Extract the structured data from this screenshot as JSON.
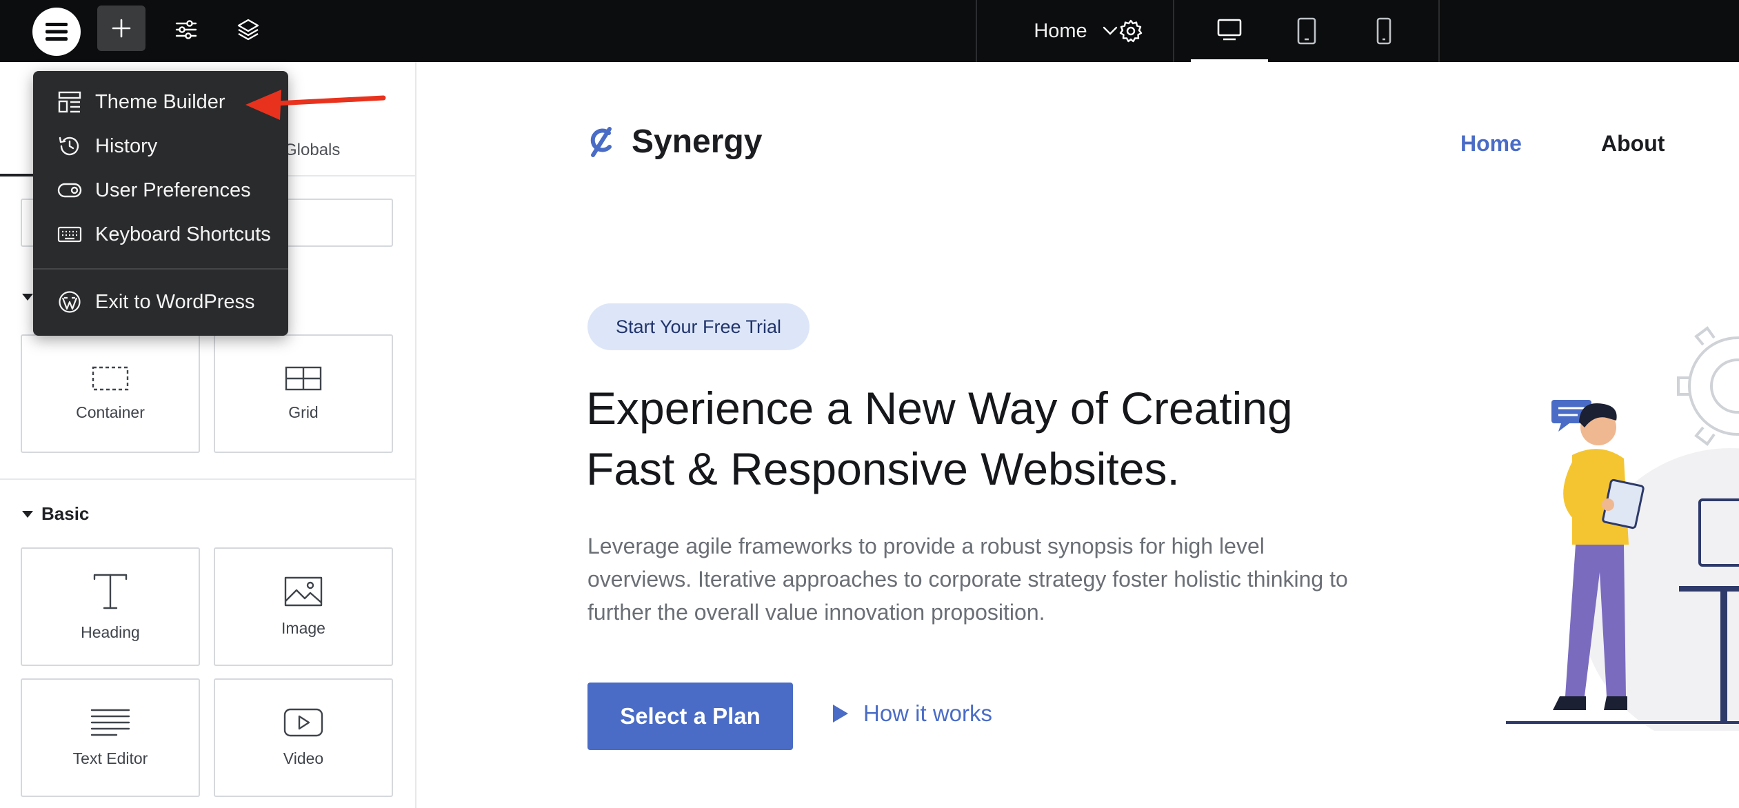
{
  "topbar": {
    "page_selector": {
      "label": "Home"
    },
    "icons": {
      "main_menu": "hamburger-icon",
      "add": "plus-icon",
      "site_settings": "sliders-icon",
      "structure": "layers-icon",
      "page_settings": "gear-icon",
      "devices": [
        "desktop-icon",
        "tablet-icon",
        "mobile-icon"
      ]
    }
  },
  "menu": {
    "items": [
      {
        "label": "Theme Builder",
        "icon": "theme-builder-icon"
      },
      {
        "label": "History",
        "icon": "history-icon"
      },
      {
        "label": "User Preferences",
        "icon": "toggle-icon"
      },
      {
        "label": "Keyboard Shortcuts",
        "icon": "keyboard-icon"
      }
    ],
    "exit": {
      "label": "Exit to WordPress",
      "icon": "wordpress-icon"
    }
  },
  "panel": {
    "tabs": {
      "globals": "Globals"
    },
    "layout_widgets": [
      {
        "label": "Container",
        "icon": "container-icon"
      },
      {
        "label": "Grid",
        "icon": "grid-icon"
      }
    ],
    "basic_section": {
      "title": "Basic"
    },
    "basic_widgets": [
      {
        "label": "Heading",
        "icon": "heading-icon"
      },
      {
        "label": "Image",
        "icon": "image-icon"
      },
      {
        "label": "Text Editor",
        "icon": "text-editor-icon"
      },
      {
        "label": "Video",
        "icon": "video-icon"
      }
    ]
  },
  "site": {
    "brand": "Synergy",
    "nav": [
      "Home",
      "About"
    ],
    "badge": "Start Your Free Trial",
    "hero_title_line1": "Experience a New Way of Creating",
    "hero_title_line2": "Fast & Responsive Websites.",
    "hero_text_line1": "Leverage agile frameworks to provide a robust synopsis for high level",
    "hero_text_line2": "overviews. Iterative approaches to corporate strategy foster holistic thinking to",
    "hero_text_line3": "further the overall value innovation proposition.",
    "cta": "Select a Plan",
    "secondary_cta": "How it works"
  },
  "colors": {
    "topbar_bg": "#0c0d0e",
    "menu_bg": "#2a2b2d",
    "accent": "#4a6cc6",
    "badge_bg": "#dde6f8",
    "annotation_arrow": "#e8321e"
  }
}
